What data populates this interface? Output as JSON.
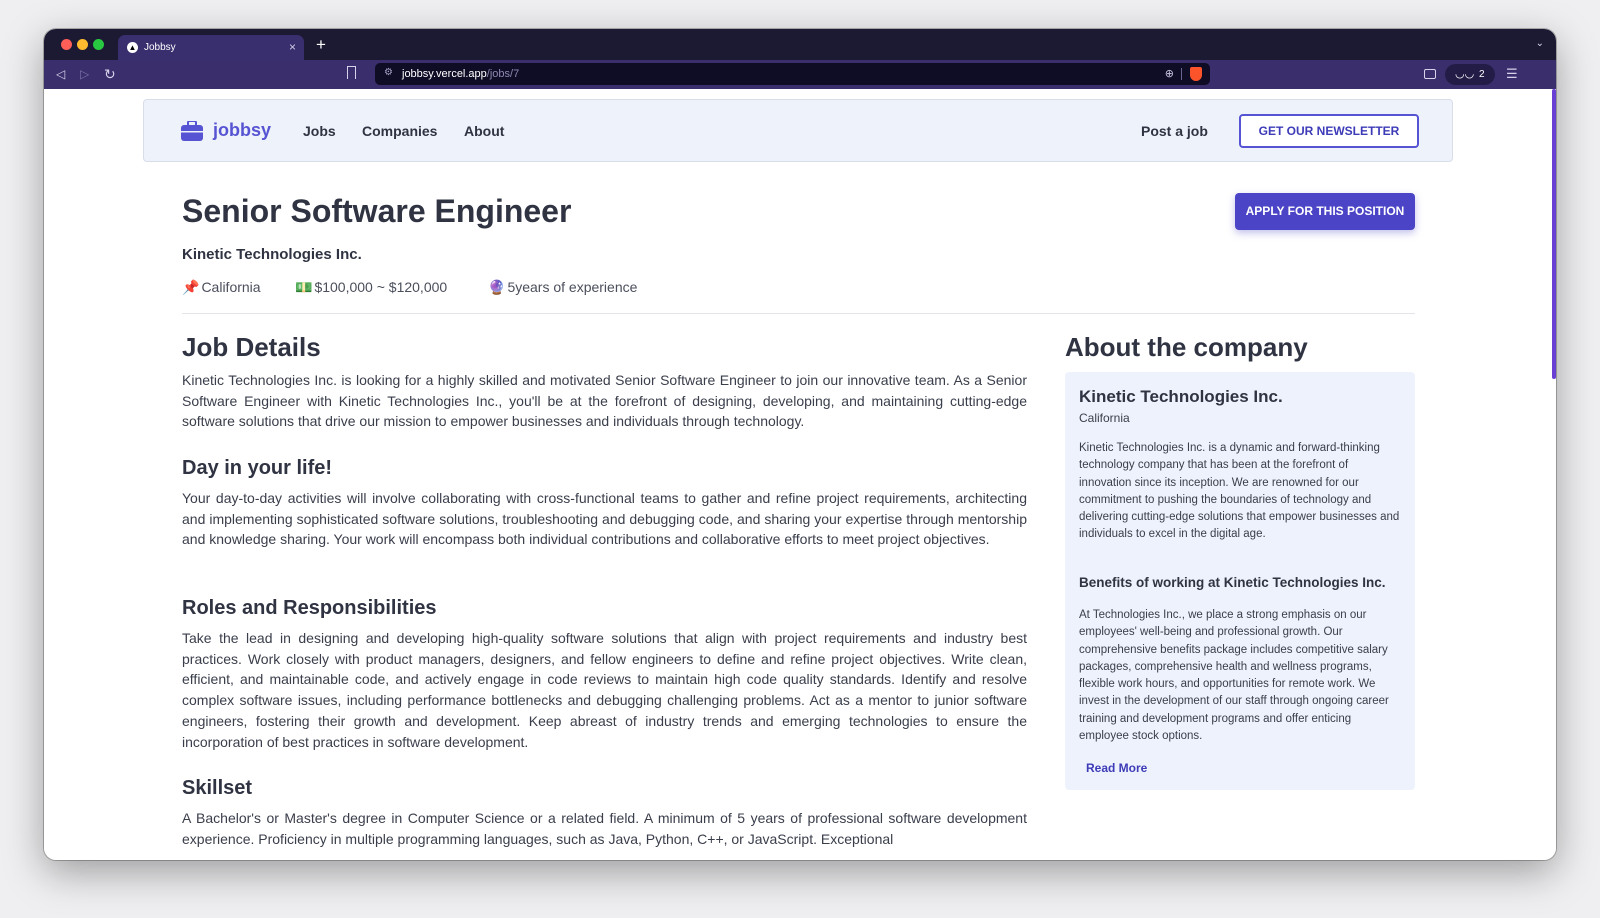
{
  "browser": {
    "tab_title": "Jobbsy",
    "tab_close": "×",
    "new_tab": "+",
    "tab_menu": "⌄",
    "url_host": "jobbsy.vercel.app",
    "url_path": "/jobs/7",
    "wallet_count": "2"
  },
  "header": {
    "logo": "jobbsy",
    "nav": [
      "Jobs",
      "Companies",
      "About"
    ],
    "post_job": "Post a job",
    "newsletter": "GET OUR NEWSLETTER"
  },
  "job": {
    "title": "Senior Software Engineer",
    "apply": "APPLY FOR THIS POSITION",
    "company": "Kinetic Technologies Inc.",
    "location": "California",
    "salary": "$100,000 ~ $120,000",
    "experience": "5years of experience",
    "icons": {
      "location": "📌",
      "salary": "💵",
      "experience": "🔮"
    }
  },
  "details": {
    "heading": "Job Details",
    "intro": "Kinetic Technologies Inc. is looking for a highly skilled and motivated Senior Software Engineer to join our innovative team. As a Senior Software Engineer with Kinetic Technologies Inc., you'll be at the forefront of designing, developing, and maintaining cutting-edge software solutions that drive our mission to empower businesses and individuals through technology.",
    "day_heading": "Day in your life!",
    "day_text": "Your day-to-day activities will involve collaborating with cross-functional teams to gather and refine project requirements, architecting and implementing sophisticated software solutions, troubleshooting and debugging code, and sharing your expertise through mentorship and knowledge sharing. Your work will encompass both individual contributions and collaborative efforts to meet project objectives.",
    "roles_heading": "Roles and Responsibilities",
    "roles_text": "Take the lead in designing and developing high-quality software solutions that align with project requirements and industry best practices. Work closely with product managers, designers, and fellow engineers to define and refine project objectives. Write clean, efficient, and maintainable code, and actively engage in code reviews to maintain high code quality standards. Identify and resolve complex software issues, including performance bottlenecks and debugging challenging problems. Act as a mentor to junior software engineers, fostering their growth and development. Keep abreast of industry trends and emerging technologies to ensure the incorporation of best practices in software development.",
    "skills_heading": "Skillset",
    "skills_text": "A Bachelor's or Master's degree in Computer Science or a related field. A minimum of 5 years of professional software development experience. Proficiency in multiple programming languages, such as Java, Python, C++, or JavaScript. Exceptional"
  },
  "about": {
    "heading": "About the company",
    "name": "Kinetic Technologies Inc.",
    "location": "California",
    "description": "Kinetic Technologies Inc. is a dynamic and forward-thinking technology company that has been at the forefront of innovation since its inception. We are renowned for our commitment to pushing the boundaries of technology and delivering cutting-edge solutions that empower businesses and individuals to excel in the digital age.",
    "benefits_heading": "Benefits of working at Kinetic Technologies Inc.",
    "benefits": "At Technologies Inc., we place a strong emphasis on our employees' well-being and professional growth. Our comprehensive benefits package includes competitive salary packages, comprehensive health and wellness programs, flexible work hours, and opportunities for remote work. We invest in the development of our staff through ongoing career training and development programs and offer enticing employee stock options.",
    "read_more": "Read More"
  }
}
